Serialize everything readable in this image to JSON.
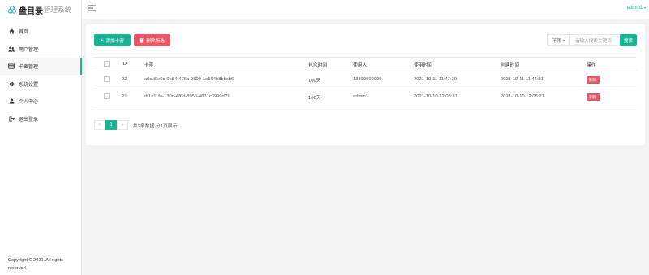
{
  "brand": {
    "name": "盘目录",
    "subtitle": "管理系统"
  },
  "sidebar": {
    "items": [
      {
        "label": "首页",
        "icon": "home-icon"
      },
      {
        "label": "用户管理",
        "icon": "users-icon"
      },
      {
        "label": "卡密管理",
        "icon": "card-icon",
        "active": true
      },
      {
        "label": "系统设置",
        "icon": "gear-icon"
      },
      {
        "label": "个人中心",
        "icon": "user-icon"
      },
      {
        "label": "退出登录",
        "icon": "logout-icon"
      }
    ],
    "copyright": "Copyright © 2021. All rights reserved."
  },
  "topbar": {
    "user": "admin1"
  },
  "toolbar": {
    "add_label": "添加卡密",
    "delete_label": "删除所选",
    "filter_value": "不限",
    "search_placeholder": "请输入搜索关键词",
    "search_label": "搜索"
  },
  "table": {
    "headers": [
      "",
      "ID",
      "卡密",
      "包含时间",
      "使用人",
      "使用时间",
      "创建时间",
      "操作"
    ],
    "rows": [
      {
        "id": "22",
        "card": "a0ad0e0c-0e84-476a-9609-1e564b8bbcb6",
        "duration": "100天",
        "user": "13800000000",
        "used_at": "2021-10-11 11:47:30",
        "created_at": "2021-10-11 11:44:31",
        "action": "删除"
      },
      {
        "id": "21",
        "card": "df1a11fa-130d-4f6d-8953-4871c3999d21",
        "duration": "100天",
        "user": "admin1",
        "used_at": "2021-10-10 12:08:31",
        "created_at": "2021-10-10 12:08:21",
        "action": "删除"
      }
    ]
  },
  "pagination": {
    "prev": "«",
    "current": "1",
    "next": "»",
    "info": "共2条数据 分1页展示"
  },
  "colors": {
    "accent": "#1ab394",
    "danger": "#ed5565",
    "background": "#f3f3f4"
  }
}
